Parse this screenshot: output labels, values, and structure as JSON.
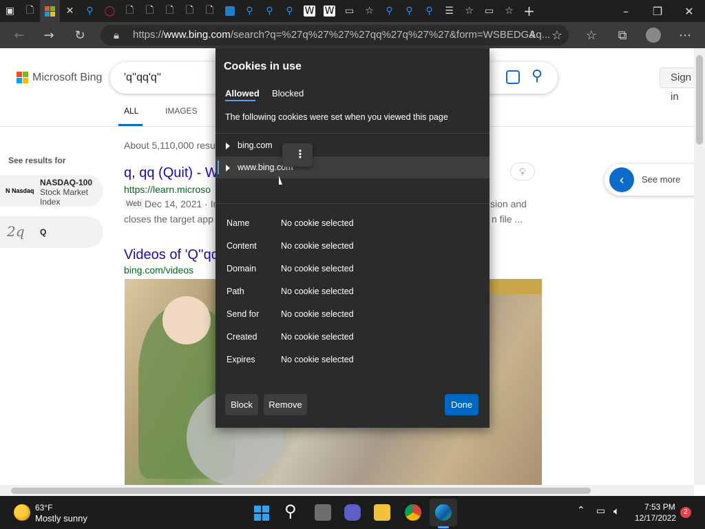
{
  "browser": {
    "url_prefix": "https://",
    "url_host": "www.bing.com",
    "url_rest": "/search?q=%27q%27%27%27qq%27q%27%27&form=WSBEDG&q..."
  },
  "bing": {
    "brand": "Microsoft Bing",
    "query": "'q''qq'q''",
    "sign_in": "Sign in",
    "nav_all": "ALL",
    "nav_images": "IMAGES",
    "result_count": "About 5,110,000 resu",
    "see_results_for": "See results for",
    "nasdaq_title": "NASDAQ-100",
    "nasdaq_line1": "Stock Market",
    "nasdaq_line2": "Index",
    "nasdaq_logo": "N Nasdaq",
    "q_label": "Q",
    "result1_title": "q, qq (Quit) - W",
    "result1_url": "https://learn.microso",
    "result1_tag": "Web",
    "result1_date": "Dec 14, 2021 · In",
    "result1_snip": "closes the target app",
    "result1_right1": "sion and",
    "result1_right2": "n file ...",
    "videos_title": "Videos of 'Q''qq",
    "videos_url": "bing.com/videos",
    "see_more": "See more"
  },
  "dialog": {
    "title": "Cookies in use",
    "tab_allowed": "Allowed",
    "tab_blocked": "Blocked",
    "description": "The following cookies were set when you viewed this page",
    "domains": [
      "bing.com",
      "www.bing.com"
    ],
    "props": [
      {
        "label": "Name",
        "value": "No cookie selected"
      },
      {
        "label": "Content",
        "value": "No cookie selected"
      },
      {
        "label": "Domain",
        "value": "No cookie selected"
      },
      {
        "label": "Path",
        "value": "No cookie selected"
      },
      {
        "label": "Send for",
        "value": "No cookie selected"
      },
      {
        "label": "Created",
        "value": "No cookie selected"
      },
      {
        "label": "Expires",
        "value": "No cookie selected"
      }
    ],
    "block": "Block",
    "remove": "Remove",
    "done": "Done"
  },
  "taskbar": {
    "temp": "63°F",
    "weather": "Mostly sunny",
    "time": "7:53 PM",
    "date": "12/17/2022",
    "notif": "2"
  },
  "colors": {
    "accent": "#0067c0",
    "link": "#1a0dab",
    "url": "#006621",
    "dialog_bg": "#2b2b2b"
  }
}
